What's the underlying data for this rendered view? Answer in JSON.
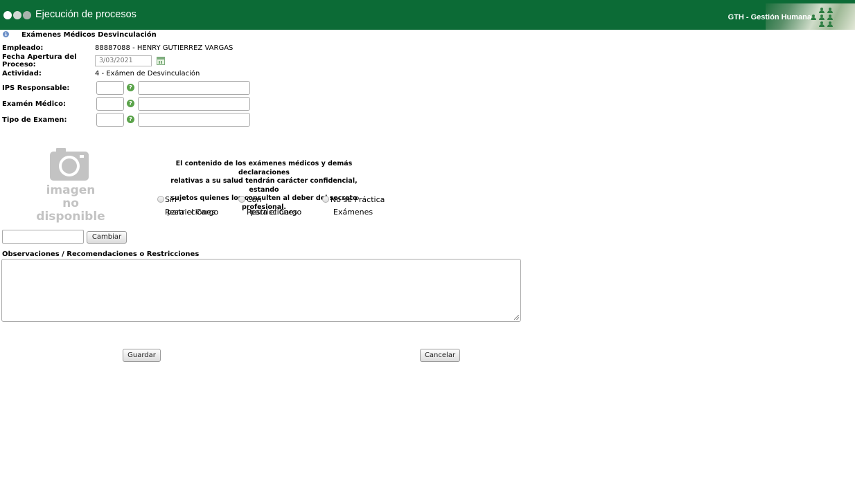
{
  "header": {
    "title": "Ejecución de procesos",
    "brand": "GTH - Gestión Humana",
    "background": "#0c6b36"
  },
  "section": {
    "icon": "info-down-icon",
    "title": "Exámenes Médicos Desvinculación"
  },
  "form": {
    "empleado_label": "Empleado:",
    "empleado_value": "88887088 - HENRY GUTIERREZ VARGAS",
    "fecha_label_1": "Fecha Apertura del",
    "fecha_label_2": "Proceso:",
    "fecha_value": "3/03/2021",
    "actividad_label": "Actividad:",
    "actividad_value": "4 - Exámen de Desvinculación",
    "ips_label": "IPS Responsable:",
    "examen_label": "Examén Médico:",
    "tipo_label": "Tipo de Examen:",
    "help_glyph": "?"
  },
  "photo": {
    "icon": "camera-icon",
    "line1": "imagen",
    "line2": "no disponible",
    "change_button": "Cambiar"
  },
  "notice": {
    "line1": "El contenido de los exámenes médicos y demás declaraciones",
    "line2": "relativas a su salud tendrán carácter confidencial, estando",
    "line3": "sujetos quienes los consulten al deber del secreto profesional."
  },
  "options": [
    {
      "line1": "Sin Restricciones",
      "line2": "para el Cargo"
    },
    {
      "line1": "Con Restricciones",
      "line2": "para el Cargo"
    },
    {
      "line1": "No se Práctica",
      "line2": "Exámenes"
    }
  ],
  "observations": {
    "label": "Observaciones / Recomendaciones o Restricciones",
    "value": ""
  },
  "actions": {
    "save": "Guardar",
    "cancel": "Cancelar"
  }
}
